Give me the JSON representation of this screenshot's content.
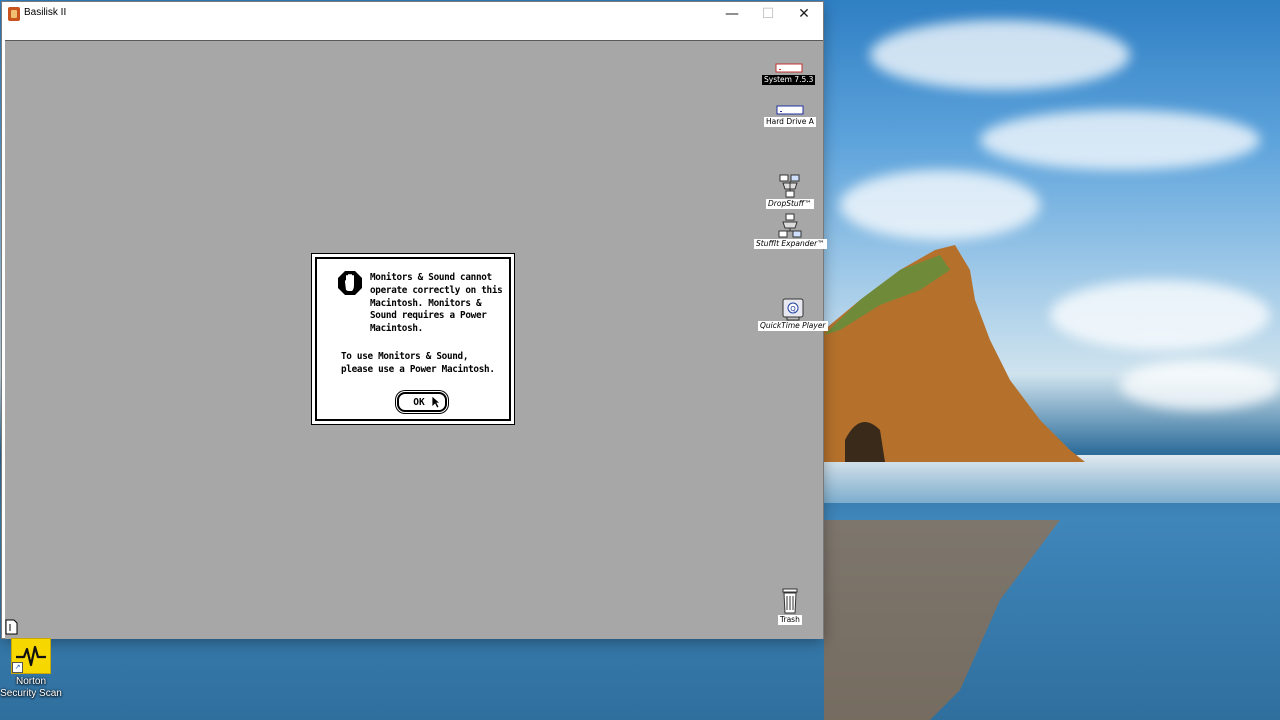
{
  "window": {
    "title": "Basilisk II",
    "controls": {
      "minimize": "—",
      "maximize": "☐",
      "close": "✕"
    }
  },
  "mac_desktop": {
    "icons": [
      {
        "label": "System 7.5.3",
        "icon": "disk-icon",
        "selected": true
      },
      {
        "label": "Hard Drive A",
        "icon": "disk-icon",
        "selected": false
      },
      {
        "label": "DropStuff™",
        "icon": "application-icon",
        "selected": false
      },
      {
        "label": "StuffIt Expander™",
        "icon": "application-icon",
        "selected": false
      },
      {
        "label": "QuickTime Player",
        "icon": "application-icon",
        "selected": false
      },
      {
        "label": "Trash",
        "icon": "trash-icon",
        "selected": false
      }
    ]
  },
  "dialog": {
    "icon": "stop-icon",
    "message": "Monitors & Sound cannot\noperate correctly on this\nMacintosh.  Monitors &\nSound requires a Power\nMacintosh.",
    "message2": "To use Monitors & Sound,\n please use a Power Macintosh.",
    "ok_label": "OK"
  },
  "windows_desktop": {
    "icons": [
      {
        "label": "Norton Security Scan",
        "icon": "norton-icon",
        "color": "#f7d700"
      }
    ]
  }
}
